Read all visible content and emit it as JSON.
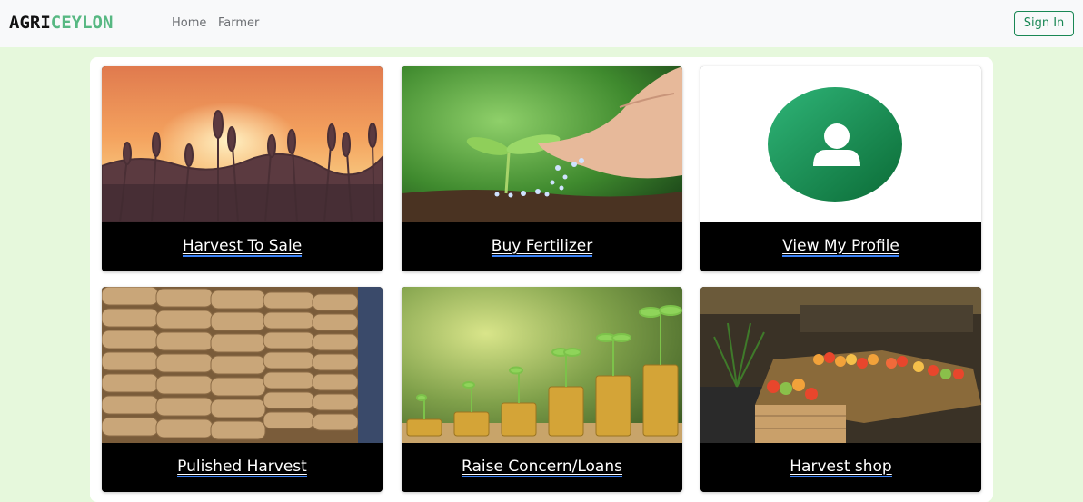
{
  "brand": {
    "part1": "AGRI",
    "part2": "CEYLON"
  },
  "nav": {
    "home": "Home",
    "farmer": "Farmer"
  },
  "signin_label": "Sign In",
  "cards": [
    {
      "label": "Harvest To Sale",
      "image": "wheat-field-sunset"
    },
    {
      "label": "Buy Fertilizer",
      "image": "hand-spreading-fertilizer-seedling"
    },
    {
      "label": "View My Profile",
      "image": "profile-user-icon"
    },
    {
      "label": "Pulished Harvest",
      "image": "stacked-grain-sacks"
    },
    {
      "label": "Raise Concern/Loans",
      "image": "coin-stacks-with-plants"
    },
    {
      "label": "Harvest shop",
      "image": "fruit-vegetable-market-stall"
    }
  ],
  "colors": {
    "accent": "#198754",
    "brand_green": "#57b882",
    "page_bg": "#e6f8dc"
  }
}
